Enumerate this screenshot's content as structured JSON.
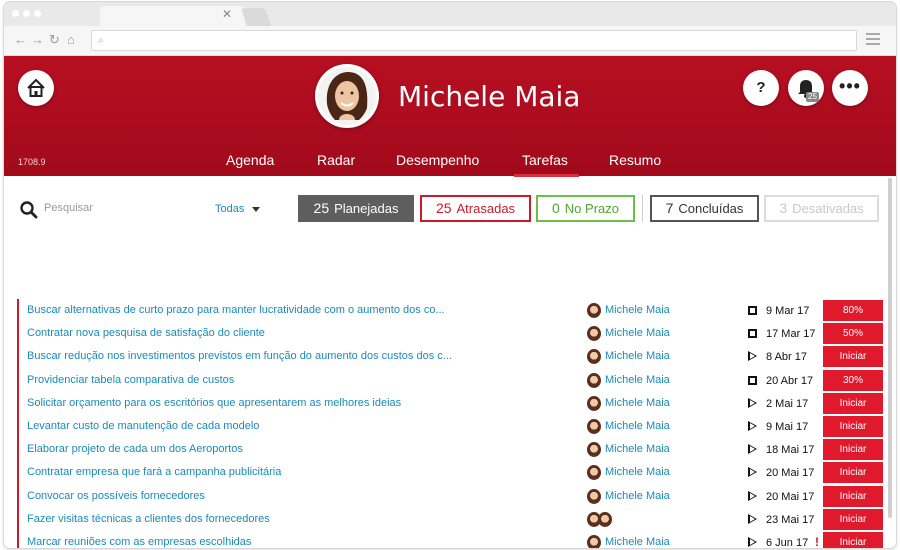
{
  "header": {
    "user_name": "Michele Maia",
    "version": "1708.9",
    "help_label": "?",
    "more_label": "•••",
    "notification_count": "25"
  },
  "nav": {
    "items": [
      {
        "label": "Agenda"
      },
      {
        "label": "Radar"
      },
      {
        "label": "Desempenho"
      },
      {
        "label": "Tarefas",
        "active": true
      },
      {
        "label": "Resumo"
      }
    ]
  },
  "toolbar": {
    "search_placeholder": "Pesquisar",
    "filter_label": "Todas",
    "pills": {
      "planned": {
        "count": "25",
        "label": "Planejadas"
      },
      "late": {
        "count": "25",
        "label": "Atrasadas"
      },
      "ontime": {
        "count": "0",
        "label": "No Prazo"
      },
      "done": {
        "count": "7",
        "label": "Concluídas"
      },
      "disabled": {
        "count": "3",
        "label": "Desativadas"
      }
    }
  },
  "tasks": [
    {
      "title": "Buscar alternativas de curto prazo para manter lucratividade com o aumento dos co...",
      "responsible": "Michele Maia",
      "status": "square",
      "date": "9 Mar 17",
      "action": "80%"
    },
    {
      "title": "Contratar nova pesquisa de satisfação do cliente",
      "responsible": "Michele Maia",
      "status": "square",
      "date": "17 Mar 17",
      "action": "50%"
    },
    {
      "title": "Buscar redução nos investimentos previstos em função do aumento dos custos dos c...",
      "responsible": "Michele Maia",
      "status": "play",
      "date": "8 Abr 17",
      "action": "Iniciar"
    },
    {
      "title": "Providenciar tabela comparativa de custos",
      "responsible": "Michele Maia",
      "status": "square",
      "date": "20 Abr 17",
      "action": "30%"
    },
    {
      "title": "Solicitar orçamento para os escritórios que apresentarem as melhores ideias",
      "responsible": "Michele Maia",
      "status": "play",
      "date": "2 Mai 17",
      "action": "Iniciar"
    },
    {
      "title": "Levantar custo de manutenção de cada modelo",
      "responsible": "Michele Maia",
      "status": "play",
      "date": "9 Mai 17",
      "action": "Iniciar"
    },
    {
      "title": "Elaborar projeto de cada um dos Aeroportos",
      "responsible": "Michele Maia",
      "status": "play",
      "date": "18 Mai 17",
      "action": "Iniciar"
    },
    {
      "title": "Contratar empresa que fará a campanha publicitária",
      "responsible": "Michele Maia",
      "status": "play",
      "date": "20 Mai 17",
      "action": "Iniciar"
    },
    {
      "title": "Convocar os possíveis fornecedores",
      "responsible": "Michele Maia",
      "status": "play",
      "date": "20 Mai 17",
      "action": "Iniciar"
    },
    {
      "title": "Fazer visitas técnicas a clientes dos fornecedores",
      "responsible": "",
      "multi_avatar": true,
      "status": "play",
      "date": "23 Mai 17",
      "action": "Iniciar"
    },
    {
      "title": "Marcar reuniões com as empresas escolhidas",
      "responsible": "Michele Maia",
      "status": "play",
      "date": "6 Jun 17",
      "alert": "!",
      "action": "Iniciar"
    }
  ],
  "colors": {
    "brand_red": "#b70f22",
    "link_blue": "#1a8bb8",
    "action_red": "#e0192c"
  }
}
